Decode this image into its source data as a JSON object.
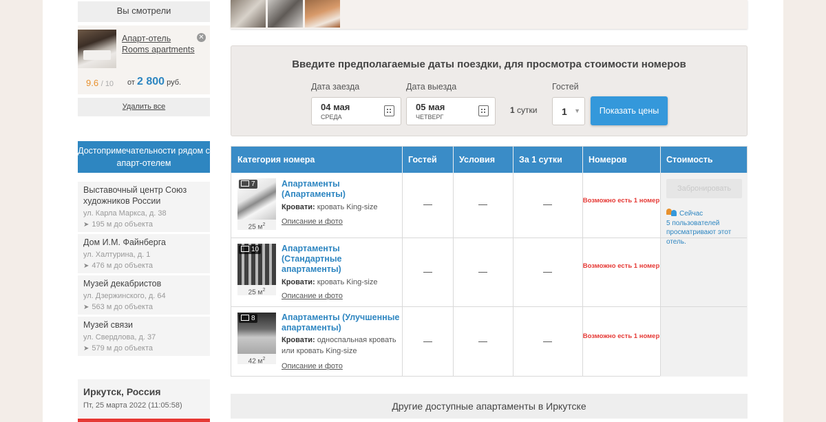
{
  "sidebar": {
    "viewed_title": "Вы смотрели",
    "viewed": {
      "name": "Апарт-отель Rooms apartments",
      "rating": "9.6",
      "rating_of": "/ 10",
      "price_prefix": "от",
      "price": "2 800",
      "currency": "руб.",
      "close_icon": "close-icon"
    },
    "clear_label": "Удалить все",
    "attractions_title": "Достопримечательности рядом с апарт-отелем",
    "attractions": [
      {
        "name": "Выставочный центр Союз художников России",
        "address": "ул. Карла Маркса, д. 38",
        "distance": "195 м до объекта"
      },
      {
        "name": "Дом И.М. Файнберга",
        "address": "ул. Халтурина, д. 1",
        "distance": "476 м до объекта"
      },
      {
        "name": "Музей декабристов",
        "address": "ул. Дзержинского, д. 64",
        "distance": "563 м до объекта"
      },
      {
        "name": "Музей связи",
        "address": "ул. Свердлова, д. 37",
        "distance": "579 м до объекта"
      }
    ],
    "city": {
      "name": "Иркутск, Россия",
      "time": "Пт, 25 марта 2022 (11:05:58)"
    }
  },
  "dates": {
    "title": "Введите предполагаемые даты поездки, для просмотра стоимости номеров",
    "checkin_label": "Дата заезда",
    "checkin_date": "04 мая",
    "checkin_day": "СРЕДА",
    "checkout_label": "Дата выезда",
    "checkout_date": "05 мая",
    "checkout_day": "ЧЕТВЕРГ",
    "nights_value": "1",
    "nights_unit": "сутки",
    "guests_label": "Гостей",
    "guests_value": "1",
    "show_button": "Показать цены"
  },
  "table": {
    "headers": [
      "Категория номера",
      "Гостей",
      "Условия",
      "За 1 сутки",
      "Номеров",
      "Стоимость"
    ],
    "beds_label": "Кровати:",
    "description_link": "Описание и фото",
    "dash": "—",
    "availability": "Возможно есть 1 номер",
    "book_button": "Забронировать",
    "viewers_now": "Сейчас",
    "viewers_text": "5 пользователей просматривают этот отель.",
    "rows": [
      {
        "photo_count": "7",
        "area": "25 м",
        "area_sup": "2",
        "name": "Апартаменты (Апартаменты)",
        "beds": "кровать King-size"
      },
      {
        "photo_count": "10",
        "area": "25 м",
        "area_sup": "2",
        "name": "Апартаменты (Стандартные апартаменты)",
        "beds": "кровать King-size"
      },
      {
        "photo_count": "8",
        "area": "42 м",
        "area_sup": "2",
        "name": "Апартаменты (Улучшенные апартаменты)",
        "beds": "односпальная кровать или кровать King-size"
      }
    ]
  },
  "other_title": "Другие доступные апартаменты в Иркутске"
}
